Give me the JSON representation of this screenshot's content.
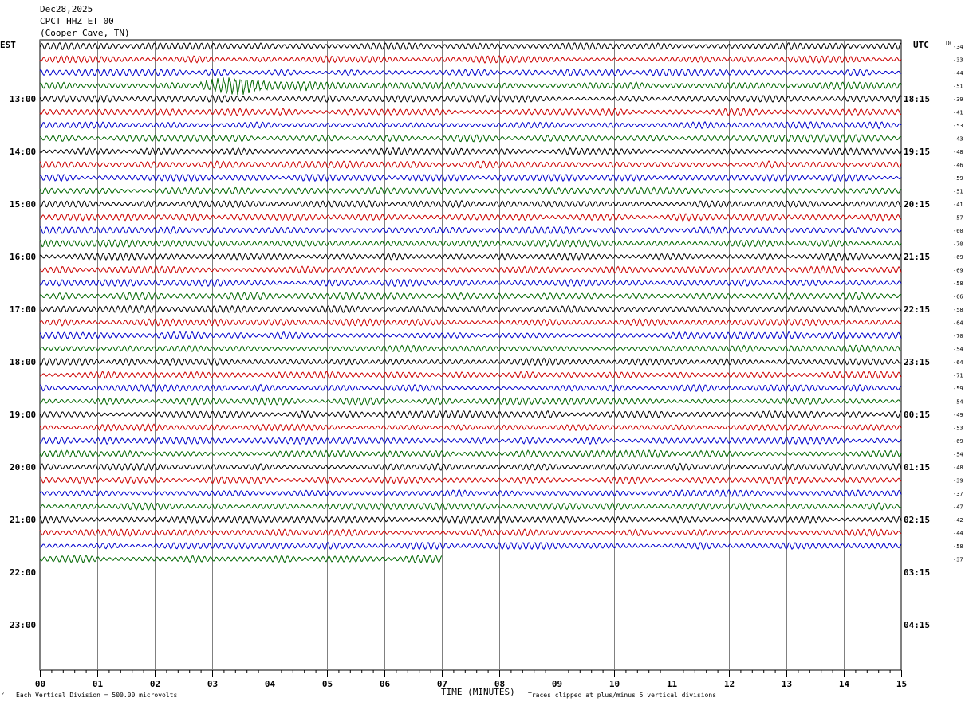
{
  "header": {
    "date": "Dec28,2025",
    "station": "CPCT HHZ ET 00",
    "location": "(Cooper Cave, TN)"
  },
  "left_zone": "EST",
  "right_zone": "UTC",
  "dc_label": "DC",
  "footer": {
    "scale": "Each Vertical Division =  500.00 microvolts",
    "xlabel": "TIME (MINUTES)",
    "clip": "Traces clipped at plus/minus 5 vertical divisions"
  },
  "chart_data": {
    "type": "line",
    "title": "Dec28,2025",
    "xlabel": "TIME (MINUTES)",
    "ylabel": "",
    "xlim": [
      0,
      15
    ],
    "x_ticks": [
      "00",
      "01",
      "02",
      "03",
      "04",
      "05",
      "06",
      "07",
      "08",
      "09",
      "10",
      "11",
      "12",
      "13",
      "14",
      "15"
    ],
    "left_hour_labels": [
      "13:00",
      "14:00",
      "15:00",
      "16:00",
      "17:00",
      "18:00",
      "19:00",
      "20:00",
      "21:00",
      "22:00",
      "23:00"
    ],
    "right_hour_labels": [
      "18:15",
      "19:15",
      "20:15",
      "21:15",
      "22:15",
      "23:15",
      "00:15",
      "01:15",
      "02:15",
      "03:15",
      "04:15"
    ],
    "dc_offsets": [
      -34,
      -33,
      -44,
      -51,
      -39,
      -41,
      -53,
      -43,
      -48,
      -46,
      -59,
      -51,
      -41,
      -57,
      -60,
      -70,
      -69,
      -69,
      -58,
      -66,
      -58,
      -64,
      -70,
      -54,
      -64,
      -71,
      -59,
      -54,
      -49,
      -53,
      -69,
      -54,
      -48,
      -39,
      -37,
      -47,
      -42,
      -44,
      -58,
      -37
    ],
    "trace_colors": [
      "#000000",
      "#cc0000",
      "#0000cc",
      "#006600"
    ],
    "traces_per_hour": 4,
    "trace_duration_minutes": 15,
    "last_trace_end_minute": 7.0,
    "event_marker": {
      "trace_index": 3,
      "start_minute": 2.8,
      "end_minute": 4.8,
      "peak_minute": 3.4
    }
  }
}
